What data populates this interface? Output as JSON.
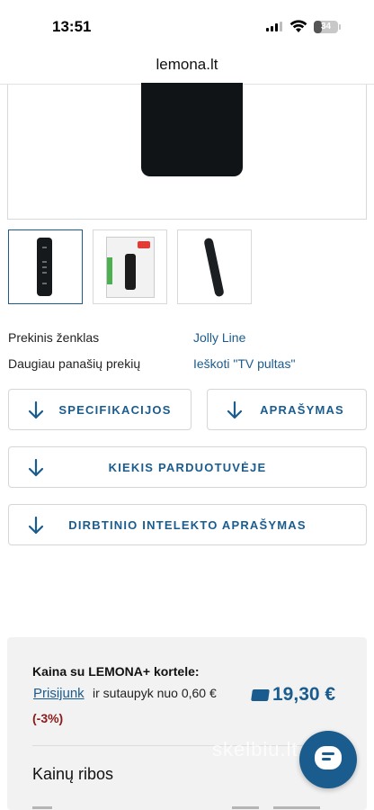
{
  "status_bar": {
    "time": "13:51",
    "battery_level": "34",
    "battery_fraction": 0.34
  },
  "browser": {
    "address": "lemona.lt"
  },
  "gallery": {
    "thumbnails": [
      {
        "label": "remote-front",
        "selected": true
      },
      {
        "label": "remote-package",
        "selected": false
      },
      {
        "label": "remote-side",
        "selected": false
      }
    ]
  },
  "attributes": [
    {
      "label": "Prekinis ženklas",
      "value": "Jolly Line"
    },
    {
      "label": "Daugiau panašių prekių",
      "value": "Ieškoti \"TV pultas\""
    }
  ],
  "buttons": {
    "specifications": "SPECIFIKACIJOS",
    "description": "APRAŠYMAS",
    "stock": "KIEKIS PARDUOTUVĖJE",
    "ai_description": "DIRBTINIO INTELEKTO APRAŠYMAS"
  },
  "price_panel": {
    "title": "Kaina su LEMONA+ kortele:",
    "login_link": "Prisijunk",
    "login_text": "ir sutaupyk nuo 0,60 €",
    "discount": "(-3%)",
    "price": "19,30 €",
    "ranges_title": "Kainų ribos"
  },
  "watermark": "skelbiu.lt",
  "colors": {
    "accent": "#1b5c8e",
    "discount": "#8b1a1a",
    "panel_bg": "#f2f2f2"
  },
  "icons": [
    "arrow-down-icon",
    "card-icon",
    "chat-icon",
    "wifi-icon",
    "signal-icon",
    "battery-icon"
  ]
}
